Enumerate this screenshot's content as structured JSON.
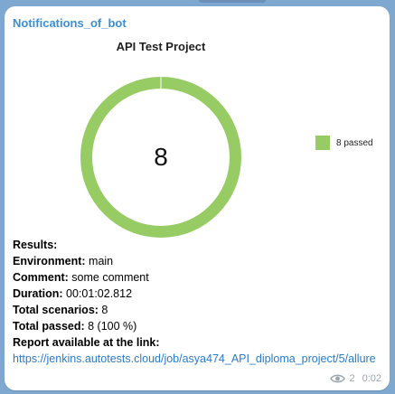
{
  "message": {
    "sender": "Notifications_of_bot",
    "views": "2",
    "time": "0:02"
  },
  "chart_data": {
    "type": "pie",
    "title": "API Test Project",
    "center_label": "8",
    "slices": [
      {
        "name": "8 passed",
        "value": 8,
        "color": "#97cc64"
      }
    ],
    "legend_position": "right"
  },
  "report": {
    "heading": "Results:",
    "environment_label": "Environment:",
    "environment_value": " main",
    "comment_label": "Comment:",
    "comment_value": " some comment",
    "duration_label": "Duration:",
    "duration_value": " 00:01:02.812",
    "total_scenarios_label": "Total scenarios:",
    "total_scenarios_value": " 8",
    "total_passed_label": "Total passed:",
    "total_passed_value": " 8 (100 %)",
    "link_label": "Report available at the link:",
    "link_url": "https://jenkins.autotests.cloud/job/asya474_API_diploma_project/5/allure"
  }
}
